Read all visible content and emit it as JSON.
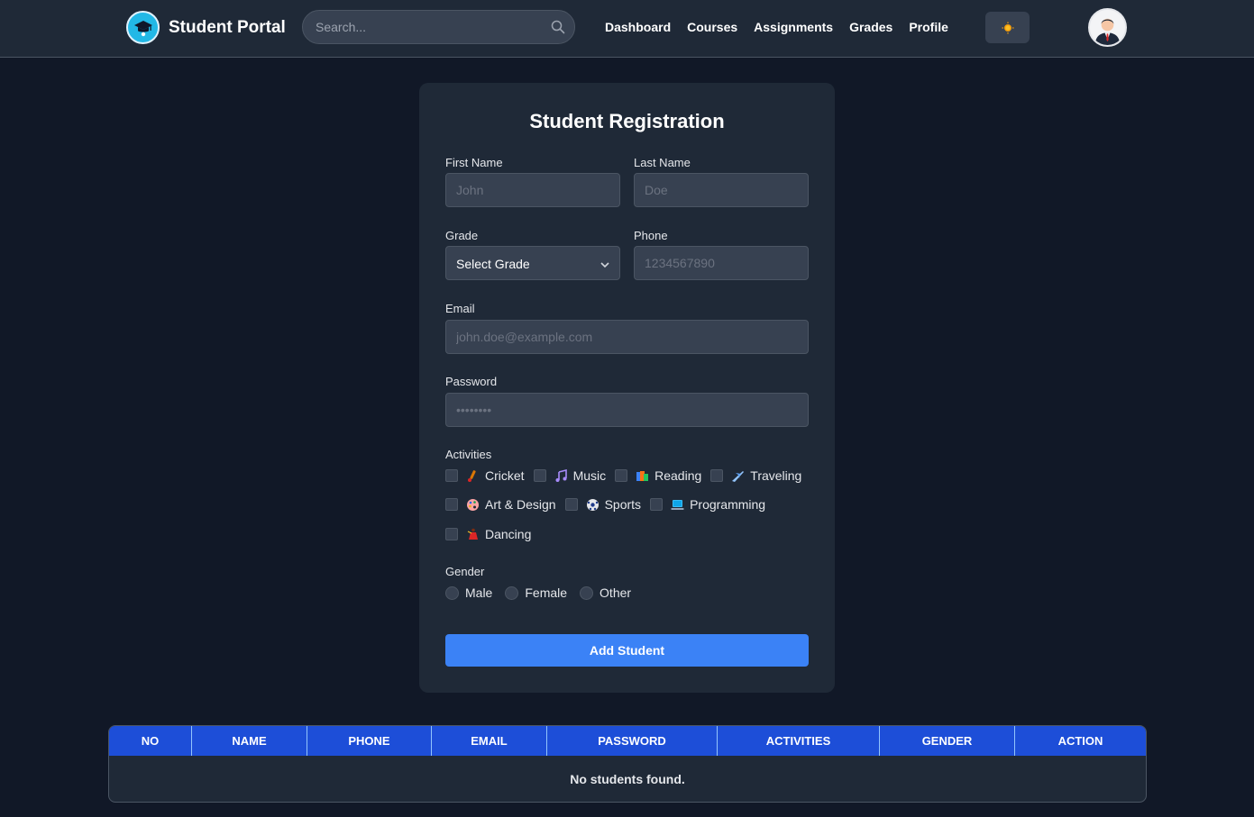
{
  "header": {
    "brand": "Student Portal",
    "search_placeholder": "Search...",
    "nav": [
      "Dashboard",
      "Courses",
      "Assignments",
      "Grades",
      "Profile"
    ],
    "theme_icon": "sun-icon",
    "avatar_icon": "user-avatar-icon"
  },
  "form": {
    "title": "Student Registration",
    "first_name": {
      "label": "First Name",
      "placeholder": "John",
      "value": ""
    },
    "last_name": {
      "label": "Last Name",
      "placeholder": "Doe",
      "value": ""
    },
    "grade": {
      "label": "Grade",
      "selected": "Select Grade"
    },
    "phone": {
      "label": "Phone",
      "placeholder": "1234567890",
      "value": ""
    },
    "email": {
      "label": "Email",
      "placeholder": "john.doe@example.com",
      "value": ""
    },
    "password": {
      "label": "Password",
      "placeholder": "••••••••",
      "value": ""
    },
    "activities": {
      "label": "Activities",
      "items": [
        {
          "label": "Cricket",
          "icon": "cricket-icon",
          "checked": false
        },
        {
          "label": "Music",
          "icon": "music-note-icon",
          "checked": false
        },
        {
          "label": "Reading",
          "icon": "books-icon",
          "checked": false
        },
        {
          "label": "Traveling",
          "icon": "airplane-icon",
          "checked": false
        },
        {
          "label": "Art & Design",
          "icon": "palette-icon",
          "checked": false
        },
        {
          "label": "Sports",
          "icon": "soccer-ball-icon",
          "checked": false
        },
        {
          "label": "Programming",
          "icon": "laptop-icon",
          "checked": false
        },
        {
          "label": "Dancing",
          "icon": "dancer-icon",
          "checked": false
        }
      ]
    },
    "gender": {
      "label": "Gender",
      "options": [
        "Male",
        "Female",
        "Other"
      ],
      "selected": null
    },
    "submit_label": "Add Student"
  },
  "table": {
    "columns": [
      "NO",
      "NAME",
      "PHONE",
      "EMAIL",
      "PASSWORD",
      "ACTIVITIES",
      "GENDER",
      "ACTION"
    ],
    "empty_message": "No students found."
  },
  "colors": {
    "background": "#111827",
    "card": "#1f2937",
    "input": "#374151",
    "accent": "#3b82f6",
    "table_header": "#1d4ed8"
  }
}
